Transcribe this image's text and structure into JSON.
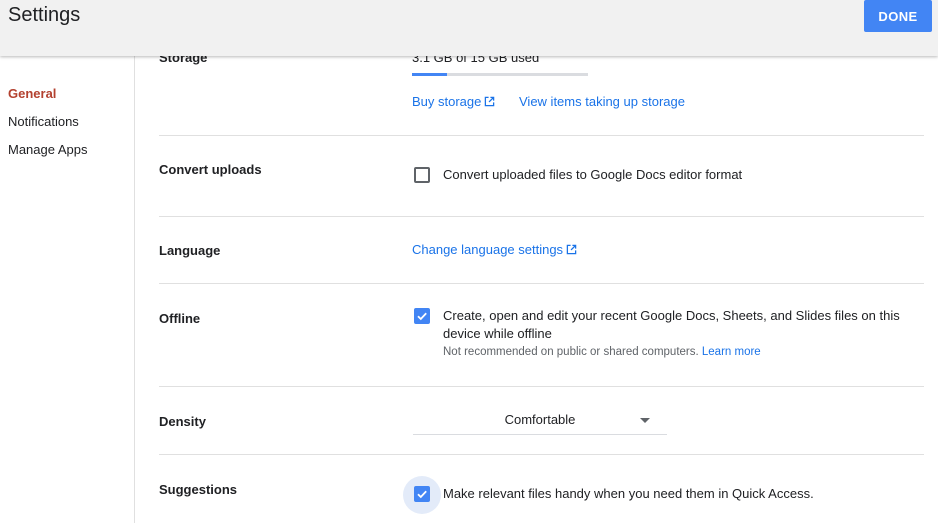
{
  "header": {
    "title": "Settings",
    "done_label": "DONE"
  },
  "sidebar": {
    "items": [
      {
        "label": "General",
        "active": true
      },
      {
        "label": "Notifications",
        "active": false
      },
      {
        "label": "Manage Apps",
        "active": false
      }
    ]
  },
  "storage": {
    "label": "Storage",
    "usage_text": "3.1 GB of 15 GB used",
    "used_fraction": 0.2,
    "buy_label": "Buy storage",
    "view_items_label": "View items taking up storage"
  },
  "convert": {
    "label": "Convert uploads",
    "option_text": "Convert uploaded files to Google Docs editor format",
    "checked": false
  },
  "language": {
    "label": "Language",
    "link_label": "Change language settings"
  },
  "offline": {
    "label": "Offline",
    "option_line1": "Create, open and edit your recent Google Docs, Sheets, and Slides files on this",
    "option_line2": "device while offline",
    "note": "Not recommended on public or shared computers.",
    "learn_more": "Learn more",
    "checked": true
  },
  "density": {
    "label": "Density",
    "value": "Comfortable"
  },
  "suggestions": {
    "label": "Suggestions",
    "option_text": "Make relevant files handy when you need them in Quick Access.",
    "checked": true
  },
  "colors": {
    "accent": "#4285f4",
    "link": "#1a73e8",
    "active_nav": "#b3412f"
  }
}
